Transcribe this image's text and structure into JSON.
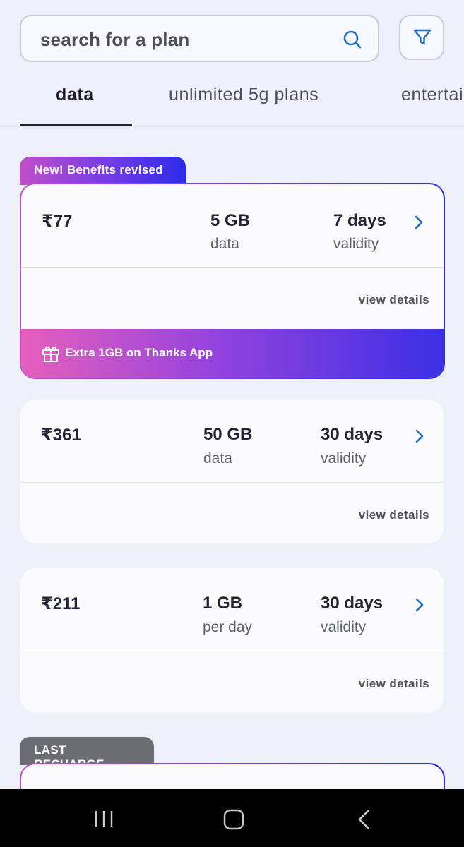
{
  "search": {
    "placeholder": "search for a plan",
    "icon": "search-icon"
  },
  "filter": {
    "icon": "filter-icon"
  },
  "tabs": [
    {
      "label": "data",
      "active": true
    },
    {
      "label": "unlimited 5g plans",
      "active": false
    },
    {
      "label": "entertainment",
      "active": false
    }
  ],
  "plans": [
    {
      "badge": "New! Benefits revised",
      "price": "₹77",
      "amount": "5 GB",
      "amount_label": "data",
      "validity": "7 days",
      "validity_label": "validity",
      "details_label": "view details",
      "benefit": "Extra 1GB on Thanks App"
    },
    {
      "price": "₹361",
      "amount": "50 GB",
      "amount_label": "data",
      "validity": "30 days",
      "validity_label": "validity",
      "details_label": "view details"
    },
    {
      "price": "₹211",
      "amount": "1 GB",
      "amount_label": "per day",
      "validity": "30 days",
      "validity_label": "validity",
      "details_label": "view details"
    }
  ],
  "last_recharge": {
    "badge": "LAST RECHARGE"
  },
  "colors": {
    "background": "#eef0f9",
    "accent_blue": "#1f6fc5",
    "gradient_start": "#e65fbd",
    "gradient_end": "#2c2be8",
    "badge_gray": "#6c6d73"
  },
  "navbar": {
    "icons": [
      "recent-apps-icon",
      "home-icon",
      "back-icon"
    ]
  }
}
